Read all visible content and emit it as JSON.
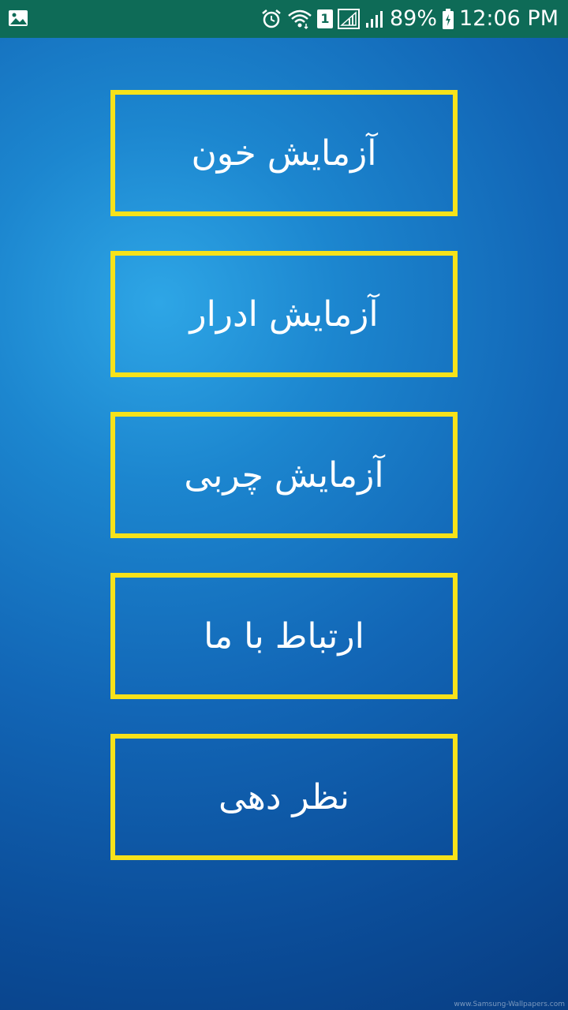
{
  "status_bar": {
    "left_icon": "gallery-icon",
    "icons": [
      "alarm-icon",
      "wifi-icon",
      "sim1-badge",
      "signal-icon",
      "signal-icon",
      "battery-charging-icon"
    ],
    "sim_label": "1",
    "battery_percent": "89%",
    "time": "12:06 PM",
    "background": "#0e6b57"
  },
  "menu": {
    "items": [
      {
        "label": "آزمایش خون"
      },
      {
        "label": "آزمایش ادرار"
      },
      {
        "label": "آزمایش چربی"
      },
      {
        "label": "ارتباط با ما"
      },
      {
        "label": "نظر دهی"
      }
    ],
    "border_color": "#f7e21a",
    "text_color": "#ffffff"
  },
  "watermark": "www.Samsung-Wallpapers.com"
}
